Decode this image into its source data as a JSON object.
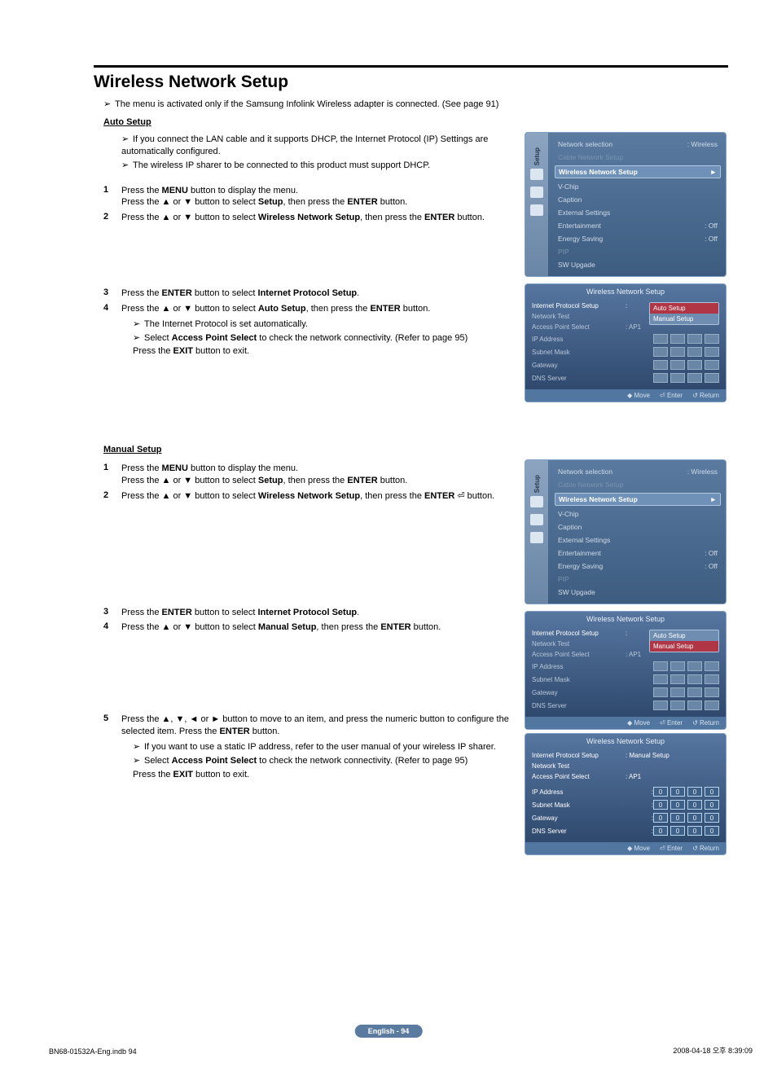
{
  "title": "Wireless Network Setup",
  "intro_note": "The menu is activated only if the Samsung Infolink Wireless adapter is connected. (See page 91)",
  "auto_setup": {
    "heading": "Auto Setup",
    "bullets": [
      "If you connect the LAN cable and it supports DHCP, the Internet Protocol (IP) Settings are automatically configured.",
      "The wireless IP sharer to be connected to this product must support DHCP."
    ],
    "step1_a": "Press the ",
    "step1_menu": "MENU",
    "step1_b": " button to display the menu.",
    "step1_c": "Press the ▲ or ▼ button to select ",
    "step1_setup": "Setup",
    "step1_d": ", then press the ",
    "step1_enter": "ENTER",
    "step1_e": " button.",
    "step2_a": "Press the ▲ or ▼ button to select ",
    "step2_wns": "Wireless Network Setup",
    "step2_b": ", then press the ",
    "step2_enter": "ENTER",
    "step2_c": " button.",
    "step3_a": "Press the ",
    "step3_enter": "ENTER",
    "step3_b": " button to select ",
    "step3_ips": "Internet Protocol Setup",
    "step3_c": ".",
    "step4_a": "Press the ▲ or ▼ button to select ",
    "step4_auto": "Auto Setup",
    "step4_b": ", then press the ",
    "step4_enter": "ENTER",
    "step4_c": " button.",
    "sub_a": "The Internet Protocol is set automatically.",
    "sub_b_a": "Select ",
    "sub_b_aps": "Access Point Select",
    "sub_b_b": " to check the network connectivity. (Refer to page 95)",
    "exit_a": "Press the ",
    "exit_btn": "EXIT",
    "exit_b": " button to exit."
  },
  "manual_setup": {
    "heading": "Manual Setup",
    "step1_a": "Press the ",
    "step1_menu": "MENU",
    "step1_b": " button to display the menu.",
    "step1_c": "Press the ▲ or ▼ button to select ",
    "step1_setup": "Setup",
    "step1_d": ", then press the ",
    "step1_enter": "ENTER",
    "step1_e": " button.",
    "step2_a": "Press the ▲ or ▼ button to select ",
    "step2_wns": "Wireless Network Setup",
    "step2_b": ", then press the ",
    "step2_enter": "ENTER",
    "step2_c": " ⏎ button.",
    "step3_a": "Press the ",
    "step3_enter": "ENTER",
    "step3_b": " button to select ",
    "step3_ips": "Internet Protocol Setup",
    "step3_c": ".",
    "step4_a": "Press the ▲ or ▼ button to select ",
    "step4_manual": "Manual Setup",
    "step4_b": ", then press the ",
    "step4_enter": "ENTER",
    "step4_c": " button.",
    "step5_a": "Press the ▲, ▼, ◄ or ► button to move to an item, and press the numeric button to configure the selected item. Press the ",
    "step5_enter": "ENTER",
    "step5_b": " button.",
    "sub_a": "If you want to use a static IP address, refer to the user manual of your wireless IP sharer.",
    "sub_b_a": "Select ",
    "sub_b_aps": "Access Point Select",
    "sub_b_b": " to check the network connectivity. (Refer to page 95)",
    "exit_a": "Press the ",
    "exit_btn": "EXIT",
    "exit_b": " button to exit."
  },
  "osd_menu": {
    "sidebar_label": "Setup",
    "net_sel": "Network selection",
    "net_sel_val": ": Wireless",
    "cable": "Cable Network Setup",
    "wns": "Wireless Network Setup",
    "vchip": "V-Chip",
    "caption": "Caption",
    "ext": "External Settings",
    "ent": "Entertainment",
    "ent_val": ": Off",
    "energy": "Energy Saving",
    "energy_val": ": Off",
    "pip": "PIP",
    "sw": "SW Upgade"
  },
  "osd_panel": {
    "title": "Wireless Network Setup",
    "ips": "Internet Protocol Setup",
    "nt": "Network Test",
    "aps": "Access Point Select",
    "aps_val": ": AP1",
    "ip": "IP Address",
    "subnet": "Subnet Mask",
    "gateway": "Gateway",
    "dns": "DNS Server",
    "auto": "Auto Setup",
    "manual": "Manual Setup",
    "manual_val": ": Manual Setup",
    "zero": "0",
    "move": "◆ Move",
    "enter": "⏎ Enter",
    "return": "↺ Return"
  },
  "page_badge": "English - 94",
  "footer_left": "BN68-01532A-Eng.indb   94",
  "footer_right": "2008-04-18   오후 8:39:09"
}
